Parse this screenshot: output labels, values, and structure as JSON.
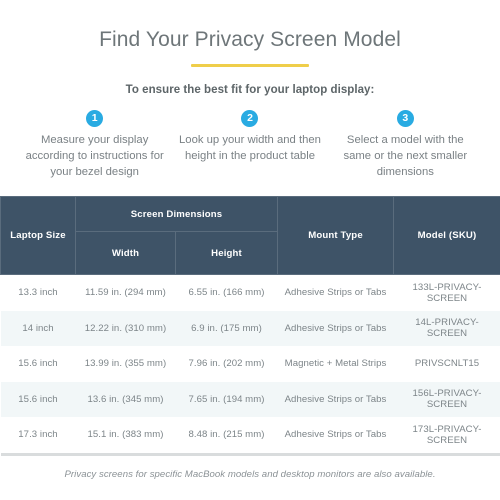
{
  "header": {
    "title": "Find Your Privacy Screen Model",
    "accent_color": "#EFCE4A",
    "subtitle": "To ensure the best fit for your laptop display:"
  },
  "steps": [
    {
      "number": "1",
      "text": "Measure your display according to instructions for your bezel design"
    },
    {
      "number": "2",
      "text": "Look up your width and then height in the product table"
    },
    {
      "number": "3",
      "text": "Select a model with the same or the next smaller dimensions"
    }
  ],
  "step_badge_color": "#29ABE2",
  "table": {
    "header_bg": "#3E5367",
    "stripe_bg": "#F2F7F8",
    "group_header": "Screen Dimensions",
    "columns": [
      "Laptop Size",
      "Width",
      "Height",
      "Mount Type",
      "Model (SKU)"
    ],
    "rows": [
      {
        "laptop_size": "13.3 inch",
        "width": "11.59 in. (294 mm)",
        "height": "6.55 in. (166 mm)",
        "mount_type": "Adhesive Strips or Tabs",
        "model_sku": "133L-PRIVACY-SCREEN"
      },
      {
        "laptop_size": "14 inch",
        "width": "12.22 in. (310 mm)",
        "height": "6.9 in. (175 mm)",
        "mount_type": "Adhesive Strips or Tabs",
        "model_sku": "14L-PRIVACY-SCREEN"
      },
      {
        "laptop_size": "15.6 inch",
        "width": "13.99 in. (355 mm)",
        "height": "7.96 in. (202 mm)",
        "mount_type": "Magnetic + Metal Strips",
        "model_sku": "PRIVSCNLT15"
      },
      {
        "laptop_size": "15.6 inch",
        "width": "13.6 in. (345 mm)",
        "height": "7.65 in. (194 mm)",
        "mount_type": "Adhesive Strips or Tabs",
        "model_sku": "156L-PRIVACY-SCREEN"
      },
      {
        "laptop_size": "17.3 inch",
        "width": "15.1 in. (383 mm)",
        "height": "8.48 in. (215 mm)",
        "mount_type": "Adhesive Strips or Tabs",
        "model_sku": "173L-PRIVACY-SCREEN"
      }
    ]
  },
  "footer": {
    "note": "Privacy screens for specific MacBook models and desktop monitors are also available."
  }
}
